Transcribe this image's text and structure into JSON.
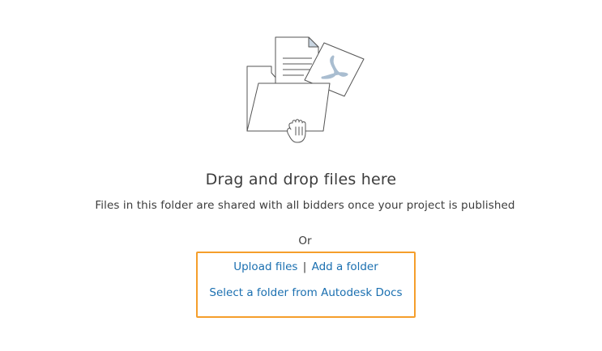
{
  "drop_zone": {
    "title": "Drag and drop files here",
    "subtitle": "Files in this folder are shared with all bidders once your project is published",
    "or_label": "Or",
    "upload_files_label": "Upload files",
    "separator": "|",
    "add_folder_label": "Add a folder",
    "autodesk_docs_label": "Select a folder from Autodesk Docs"
  },
  "colors": {
    "link": "#1a6fb0",
    "highlight_border": "#f59e2b",
    "text": "#3c3c3c",
    "illustration_stroke": "#555555",
    "acrobat_accent": "#a9bdd0"
  },
  "icons": {
    "illustration": "folder-with-documents-and-hand-icon",
    "pdf": "acrobat-pdf-icon",
    "hand": "grab-hand-icon"
  }
}
